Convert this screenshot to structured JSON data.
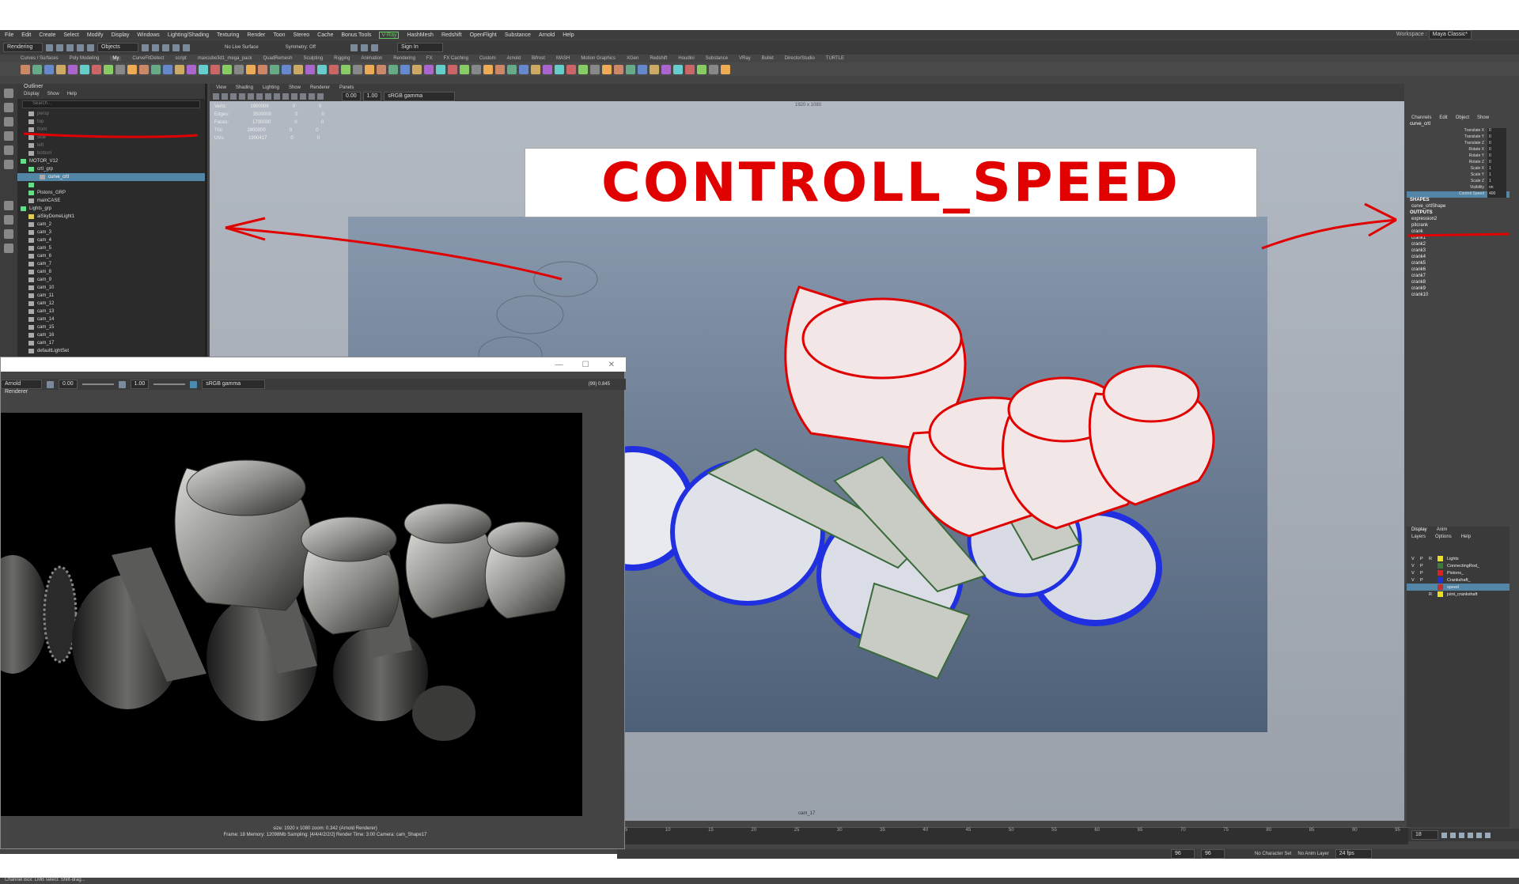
{
  "menubar": [
    "File",
    "Edit",
    "Create",
    "Select",
    "Modify",
    "Display",
    "Windows",
    "Lighting/Shading",
    "Texturing",
    "Render",
    "Toon",
    "Stereo",
    "Cache",
    "Bonus Tools",
    "V-Ray",
    "HashMesh",
    "Redshift",
    "OpenFlight",
    "Substance",
    "Arnold",
    "Help"
  ],
  "workspace": {
    "label": "Workspace :",
    "value": "Maya Classic*"
  },
  "status": {
    "mode": "Rendering",
    "objects": "Objects",
    "live_surface": "No Live Surface",
    "symmetry": "Symmetry: Off",
    "sign_in": "Sign In"
  },
  "shelf_tabs": [
    "Curves / Surfaces",
    "Poly Modeling",
    "My",
    "CurveFitDetect",
    "script",
    "maxcube3d1_mega_pack",
    "QuadRemesh",
    "Sculpting",
    "Rigging",
    "Animation",
    "Rendering",
    "FX",
    "FX Caching",
    "Custom",
    "Arnold",
    "Bifrost",
    "MASH",
    "Motion Graphics",
    "XGen",
    "Redshift",
    "Houdini",
    "Substance",
    "VRay",
    "Bullet",
    "DirectorStudio",
    "TURTLE"
  ],
  "outliner": {
    "title": "Outliner",
    "menus": [
      "Display",
      "Show",
      "Help"
    ],
    "search_placeholder": "Search...",
    "rows": [
      {
        "label": "persp",
        "icon": "camera-icon",
        "indent": 14,
        "dim": true
      },
      {
        "label": "top",
        "icon": "camera-icon",
        "indent": 14,
        "dim": true
      },
      {
        "label": "front",
        "icon": "camera-icon",
        "indent": 14,
        "dim": true
      },
      {
        "label": "side",
        "icon": "camera-icon",
        "indent": 14,
        "dim": true
      },
      {
        "label": "left",
        "icon": "camera-icon",
        "indent": 14,
        "dim": true
      },
      {
        "label": "bottom",
        "icon": "camera-icon",
        "indent": 14,
        "dim": true
      },
      {
        "label": "MOTOR_V12",
        "icon": "group-icon",
        "indent": 4
      },
      {
        "label": "crtl_grp",
        "icon": "group-icon",
        "indent": 14
      },
      {
        "label": "curve_crtl",
        "icon": "curve-icon",
        "indent": 28,
        "selected": true
      },
      {
        "label": "",
        "icon": "group-icon",
        "indent": 14
      },
      {
        "label": "Pistons_GRP",
        "icon": "group-icon",
        "indent": 14
      },
      {
        "label": "mainCASE",
        "icon": "mesh-icon",
        "indent": 14
      },
      {
        "label": "Lights_grp",
        "icon": "group-icon",
        "indent": 4
      },
      {
        "label": "aiSkyDomeLight1",
        "icon": "light-icon",
        "indent": 14
      },
      {
        "label": "cam_2",
        "icon": "camera-icon",
        "indent": 14
      },
      {
        "label": "cam_3",
        "icon": "camera-icon",
        "indent": 14
      },
      {
        "label": "cam_4",
        "icon": "camera-icon",
        "indent": 14
      },
      {
        "label": "cam_5",
        "icon": "camera-icon",
        "indent": 14
      },
      {
        "label": "cam_6",
        "icon": "camera-icon",
        "indent": 14
      },
      {
        "label": "cam_7",
        "icon": "camera-icon",
        "indent": 14
      },
      {
        "label": "cam_8",
        "icon": "camera-icon",
        "indent": 14
      },
      {
        "label": "cam_9",
        "icon": "camera-icon",
        "indent": 14
      },
      {
        "label": "cam_10",
        "icon": "camera-icon",
        "indent": 14
      },
      {
        "label": "cam_11",
        "icon": "camera-icon",
        "indent": 14
      },
      {
        "label": "cam_12",
        "icon": "camera-icon",
        "indent": 14
      },
      {
        "label": "cam_13",
        "icon": "camera-icon",
        "indent": 14
      },
      {
        "label": "cam_14",
        "icon": "camera-icon",
        "indent": 14
      },
      {
        "label": "cam_15",
        "icon": "camera-icon",
        "indent": 14
      },
      {
        "label": "cam_16",
        "icon": "camera-icon",
        "indent": 14
      },
      {
        "label": "cam_17",
        "icon": "camera-icon",
        "indent": 14
      },
      {
        "label": "defaultLightSet",
        "icon": "set-icon",
        "indent": 14
      }
    ]
  },
  "viewport": {
    "menus": [
      "View",
      "Shading",
      "Lighting",
      "Show",
      "Renderer",
      "Panels"
    ],
    "exposure": "0.00",
    "gamma": "1.00",
    "colorspace": "sRGB gamma",
    "resolution": "1920 x 1080",
    "camera": "cam_17",
    "hud": [
      {
        "k": "Verts:",
        "a": "1900009",
        "b": "0",
        "c": "0"
      },
      {
        "k": "Edges:",
        "a": "3500000",
        "b": "0",
        "c": "0"
      },
      {
        "k": "Faces:",
        "a": "1700000",
        "b": "0",
        "c": "0"
      },
      {
        "k": "Tris:",
        "a": "2800000",
        "b": "0",
        "c": "0"
      },
      {
        "k": "UVs:",
        "a": "1900417",
        "b": "0",
        "c": "0"
      }
    ]
  },
  "banner_text": "CONTROLL_SPEED",
  "annotation_color": "#e00000",
  "channel_box": {
    "tabs": [
      "Channels",
      "Edit",
      "Object",
      "Show"
    ],
    "object": "curve_crtl",
    "attrs": [
      {
        "name": "Translate X",
        "value": "0"
      },
      {
        "name": "Translate Y",
        "value": "0"
      },
      {
        "name": "Translate Z",
        "value": "0"
      },
      {
        "name": "Rotate X",
        "value": "0"
      },
      {
        "name": "Rotate Y",
        "value": "0"
      },
      {
        "name": "Rotate Z",
        "value": "0"
      },
      {
        "name": "Scale X",
        "value": "1"
      },
      {
        "name": "Scale Y",
        "value": "1"
      },
      {
        "name": "Scale Z",
        "value": "1"
      },
      {
        "name": "Visibility",
        "value": "on"
      },
      {
        "name": "Control Speed",
        "value": "400",
        "highlight": true
      }
    ],
    "shapes_header": "SHAPES",
    "shapes": [
      "curve_crtlShape"
    ],
    "outputs_header": "OUTPUTS",
    "outputs": [
      "expression2",
      "pitcrank",
      "crank",
      "crank1",
      "crank2",
      "crank3",
      "crank4",
      "crank5",
      "crank6",
      "crank7",
      "crank8",
      "crank9",
      "crank10"
    ]
  },
  "layer_editor": {
    "tabs": [
      "Display",
      "Anim"
    ],
    "menus": [
      "Layers",
      "Options",
      "Help"
    ],
    "layers": [
      {
        "v": "V",
        "p": "P",
        "r": "R",
        "name": "Lights",
        "color": "#e8e020"
      },
      {
        "v": "V",
        "p": "P",
        "r": "",
        "name": "ConnectingRod_",
        "color": "#3a7a3a"
      },
      {
        "v": "V",
        "p": "P",
        "r": "",
        "name": "Pistons_",
        "color": "#e02020"
      },
      {
        "v": "V",
        "p": "P",
        "r": "",
        "name": "Crankshaft_",
        "color": "#2030e0"
      },
      {
        "v": "",
        "p": "",
        "r": "",
        "name": "speed",
        "color": "#c03030",
        "selected": true
      },
      {
        "v": "",
        "p": "",
        "r": "R",
        "name": "joint_crankshaft",
        "color": "#e8e020"
      }
    ]
  },
  "timeline": {
    "ticks": [
      "5",
      "10",
      "15",
      "20",
      "25",
      "30",
      "35",
      "40",
      "45",
      "50",
      "55",
      "60",
      "65",
      "70",
      "75",
      "80",
      "85",
      "90",
      "95"
    ],
    "current_frame": "18",
    "start": "96",
    "end": "96",
    "character_set": "No Character Set",
    "anim_layer": "No Anim Layer",
    "fps": "24 fps"
  },
  "render_window": {
    "renderer": "Arnold Renderer",
    "exposure": "0.00",
    "gamma": "1.00",
    "colorspace": "sRGB gamma",
    "zoom_readout": "(99) 0.845",
    "info_line1": "size: 1920 x 1080  zoom: 0.342    (Arnold Renderer)",
    "info_line2": "Frame: 18    Memory: 12098Mb    Sampling: [4/4/4/2/2/2]    Render Time: 3:00    Camera: cam_Shape17"
  },
  "help_line": "Channel Box: LMB select. Shift-drag..."
}
